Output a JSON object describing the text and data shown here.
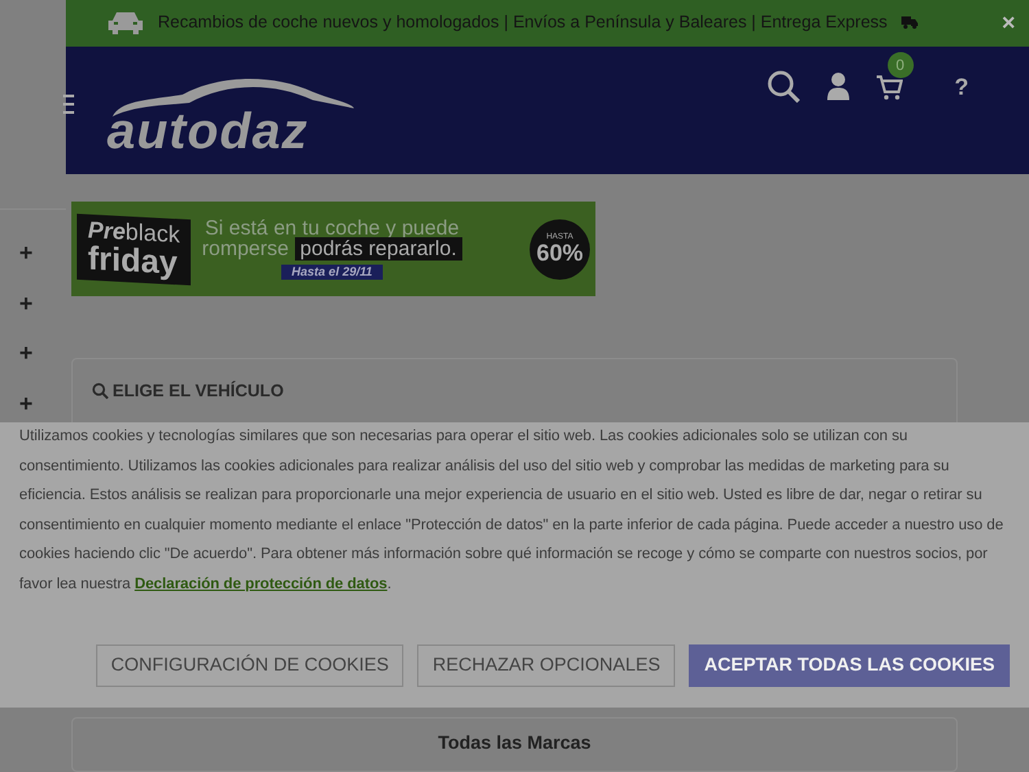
{
  "promo_bar": {
    "text": "Recambios de coche nuevos y homologados | Envíos a Península y Baleares | Entrega Express",
    "close": "×"
  },
  "header": {
    "logo": "autodaz",
    "cart_count": "0",
    "help": "?"
  },
  "sidebar": {
    "items": [
      "+",
      "+",
      "+",
      "+"
    ]
  },
  "banner": {
    "pre": "Pre",
    "black": "black",
    "friday": "friday",
    "line_1": "Si está en tu coche y puede",
    "line_2a": "romperse",
    "line_2b": "podrás repararlo.",
    "until": "Hasta el 29/11",
    "badge_top": "HASTA",
    "badge_value": "60%"
  },
  "vehicle_card": {
    "title": "ELIGE EL VEHÍCULO"
  },
  "brands_card": {
    "title": "Todas las Marcas"
  },
  "cookie_banner": {
    "text": "Utilizamos cookies y tecnologías similares que son necesarias para operar el sitio web. Las cookies adicionales solo se utilizan con su consentimiento. Utilizamos las cookies adicionales para realizar análisis del uso del sitio web y comprobar las medidas de marketing para su eficiencia. Estos análisis se realizan para proporcionarle una mejor experiencia de usuario en el sitio web. Usted es libre de dar, negar o retirar su consentimiento en cualquier momento mediante el enlace \"Protección de datos\" en la parte inferior de cada página. Puede acceder a nuestro uso de cookies haciendo clic \"De acuerdo\". Para obtener más información sobre qué información se recoge y cómo se comparte con nuestros socios, por favor lea nuestra",
    "link": "Declaración de protección de datos",
    "text_end": ".",
    "buttons": [
      {
        "label": "CONFIGURACIÓN DE COOKIES",
        "kind": "outline"
      },
      {
        "label": "RECHAZAR OPCIONALES",
        "kind": "outline"
      },
      {
        "label": "ACEPTAR TODAS LAS COOKIES",
        "kind": "primary"
      }
    ]
  }
}
